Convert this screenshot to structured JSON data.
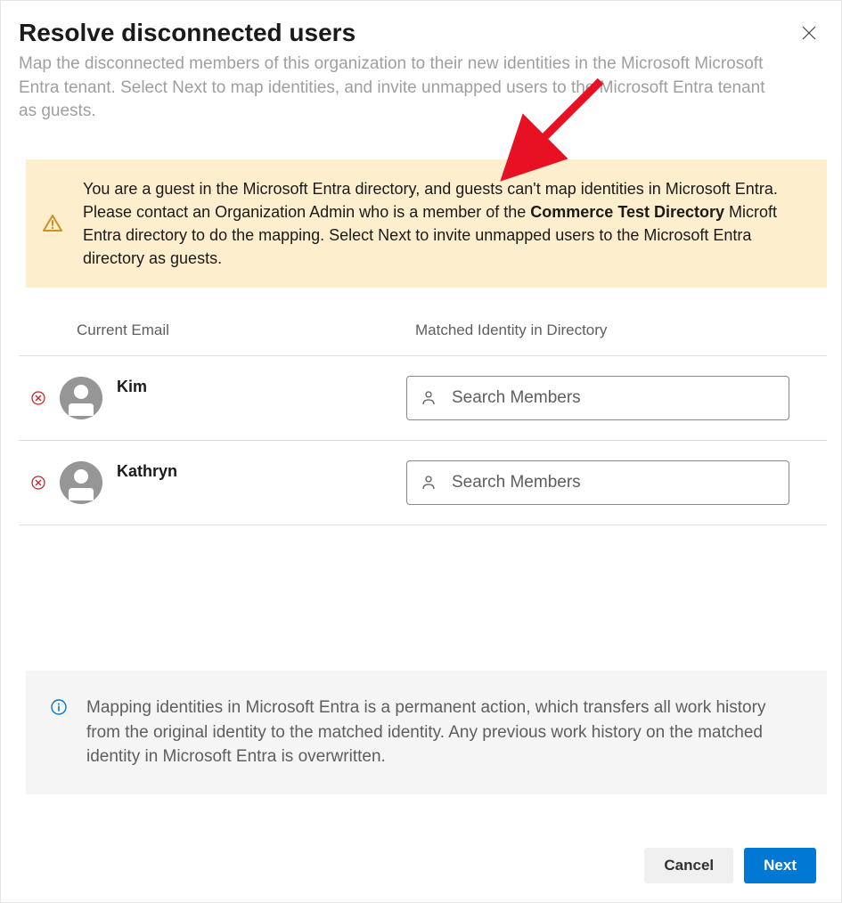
{
  "dialog": {
    "title": "Resolve disconnected users",
    "subtitle": "Map the disconnected members of this organization to their new identities in the Microsoft Microsoft Entra tenant. Select Next to map identities, and invite unmapped users to the Microsoft Entra tenant as guests."
  },
  "warning": {
    "text_before": "You are a guest in the Microsoft Entra directory, and guests can't map identities in Microsoft Entra. Please contact an Organization Admin who is a member of the ",
    "bold_text": "Commerce Test Directory",
    "text_after": " Microft Entra directory to do the mapping. Select Next to invite unmapped users to the Microsoft Entra directory as guests."
  },
  "table": {
    "columns": {
      "current": "Current Email",
      "matched": "Matched Identity in Directory"
    },
    "rows": [
      {
        "name": "Kim",
        "search_placeholder": "Search Members"
      },
      {
        "name": "Kathryn",
        "search_placeholder": "Search Members"
      }
    ]
  },
  "info": {
    "text": "Mapping identities in Microsoft Entra is a permanent action, which transfers all work history from the original identity to the matched identity. Any previous work history on the matched identity in Microsoft Entra is overwritten."
  },
  "footer": {
    "cancel": "Cancel",
    "next": "Next"
  }
}
